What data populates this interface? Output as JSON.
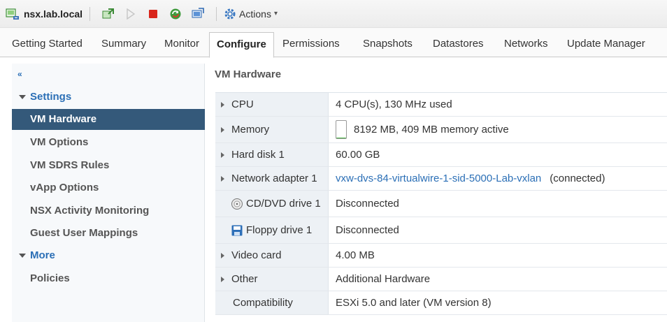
{
  "toolbar": {
    "vm_name": "nsx.lab.local",
    "actions_label": "Actions"
  },
  "tabs": [
    {
      "label": "Getting Started"
    },
    {
      "label": "Summary"
    },
    {
      "label": "Monitor"
    },
    {
      "label": "Configure"
    },
    {
      "label": "Permissions"
    },
    {
      "label": "Snapshots"
    },
    {
      "label": "Datastores"
    },
    {
      "label": "Networks"
    },
    {
      "label": "Update Manager"
    }
  ],
  "sidebar": {
    "collapse_glyph": "«",
    "settings_label": "Settings",
    "items": [
      {
        "label": "VM Hardware"
      },
      {
        "label": "VM Options"
      },
      {
        "label": "VM SDRS Rules"
      },
      {
        "label": "vApp Options"
      },
      {
        "label": "NSX Activity Monitoring"
      },
      {
        "label": "Guest User Mappings"
      }
    ],
    "more_label": "More",
    "more_items": [
      {
        "label": "Policies"
      }
    ]
  },
  "main": {
    "title": "VM Hardware",
    "rows": [
      {
        "label": "CPU",
        "value": "4 CPU(s), 130 MHz used"
      },
      {
        "label": "Memory",
        "value": "8192 MB, 409 MB memory active",
        "memory_active_fraction": 0.05
      },
      {
        "label": "Hard disk 1",
        "value": "60.00 GB"
      },
      {
        "label": "Network adapter 1",
        "value_link": "vxw-dvs-84-virtualwire-1-sid-5000-Lab-vxlan",
        "value_suffix": "(connected)"
      },
      {
        "label": "CD/DVD drive 1",
        "value": "Disconnected"
      },
      {
        "label": "Floppy drive 1",
        "value": "Disconnected"
      },
      {
        "label": "Video card",
        "value": "4.00 MB"
      },
      {
        "label": "Other",
        "value": "Additional Hardware"
      },
      {
        "label": "Compatibility",
        "value": "ESXi 5.0 and later (VM version 8)"
      }
    ]
  },
  "colors": {
    "selected_nav_bg": "#34597a",
    "link": "#2b6fb6",
    "memory_bar": "#4cb848",
    "stop_red": "#d9261c"
  },
  "icons": [
    "vm-icon",
    "migrate-icon",
    "power-on-icon",
    "power-off-icon",
    "refresh-icon",
    "console-icon",
    "gear-icon",
    "cd-icon",
    "floppy-icon"
  ]
}
